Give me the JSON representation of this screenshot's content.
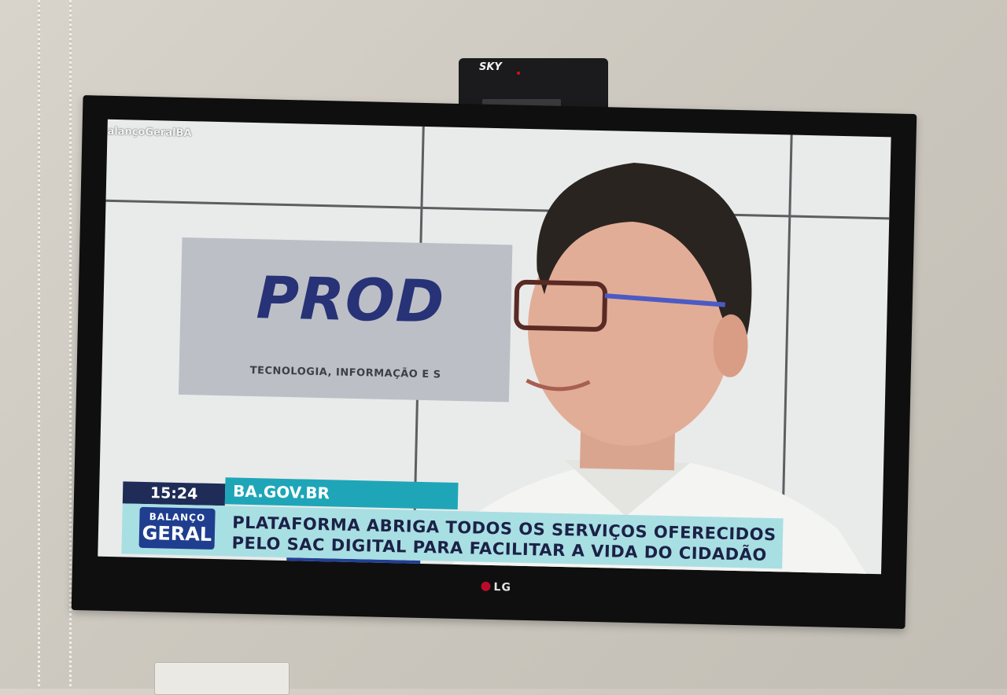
{
  "receiver": {
    "brand": "SKY"
  },
  "tv": {
    "brand": "LG"
  },
  "broadcast": {
    "channel_bug": "alançoGeralBA",
    "background_sign": {
      "logo_text": "PROD",
      "tagline": "TECNOLOGIA, INFORMAÇÃO E S"
    },
    "lower_third": {
      "time": "15:24",
      "tag": "BA.GOV.BR",
      "show_logo_line1": "BALANÇO",
      "show_logo_line2": "GERAL",
      "headline_line1": "PLATAFORMA ABRIGA TODOS OS SERVIÇOS OFERECIDOS",
      "headline_line2": "PELO SAC DIGITAL PARA FACILITAR A VIDA DO CIDADÃO"
    }
  },
  "colors": {
    "wall": "#cfcbc2",
    "tv_bezel": "#0f0f10",
    "ticker_accent": "#1ea6b8",
    "ticker_bar": "#a8dfe3",
    "clock_bg": "#1f2c57",
    "headline_text": "#1c2147",
    "sign_logo": "#283277"
  }
}
